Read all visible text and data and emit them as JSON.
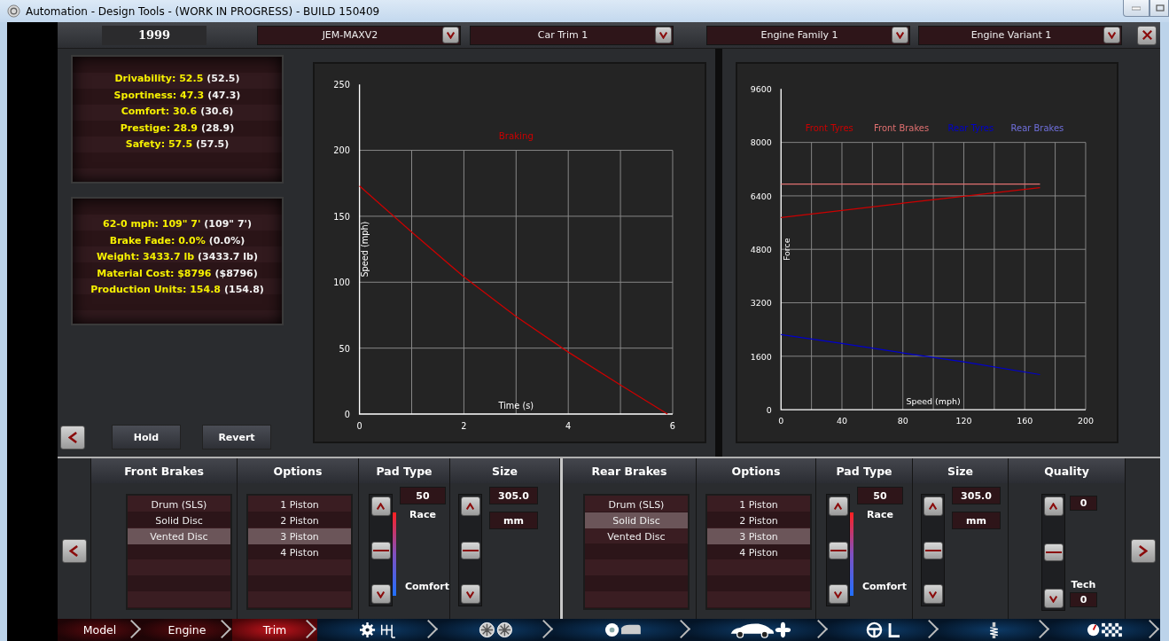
{
  "window": {
    "title": "Automation - Design Tools - (WORK IN PROGRESS) - BUILD 150409"
  },
  "top_bar": {
    "year": "1999",
    "dropdowns": [
      {
        "value": "JEM-MAXV2"
      },
      {
        "value": "Car Trim 1"
      },
      {
        "value": "Engine Family 1"
      },
      {
        "value": "Engine Variant 1"
      }
    ]
  },
  "rating_stats": [
    {
      "text": "Drivability: 52.5",
      "baseline": "(52.5)"
    },
    {
      "text": "Sportiness: 47.3",
      "baseline": "(47.3)"
    },
    {
      "text": "Comfort: 30.6",
      "baseline": "(30.6)"
    },
    {
      "text": "Prestige: 28.9",
      "baseline": "(28.9)"
    },
    {
      "text": "Safety: 57.5",
      "baseline": "(57.5)"
    }
  ],
  "performance_stats": [
    {
      "text": "62-0 mph: 109\" 7'",
      "baseline": "(109\" 7')"
    },
    {
      "text": "Brake Fade: 0.0%",
      "baseline": "(0.0%)"
    },
    {
      "text": "Weight: 3433.7 lb",
      "baseline": "(3433.7 lb)"
    },
    {
      "text": "Material Cost: $8796",
      "baseline": "($8796)"
    },
    {
      "text": "Production Units: 154.8",
      "baseline": "(154.8)"
    }
  ],
  "buttons": [
    "Hold",
    "Revert"
  ],
  "charts": [
    {
      "chart_data": {
        "type": "line",
        "grid": true,
        "xlabel": "Time (s)",
        "ylabel": "Speed (mph)",
        "x": [
          0,
          1,
          2,
          3,
          4,
          5,
          5.9
        ],
        "xlim": [
          0,
          6
        ],
        "ylim": [
          0,
          250
        ],
        "xticks": [
          0,
          2,
          4,
          6
        ],
        "yticks": [
          0,
          50,
          100,
          150,
          200,
          250
        ],
        "series": [
          {
            "name": "Braking",
            "color": "#cc0000",
            "values": [
              173,
              138,
              104,
              74,
              47,
              22,
              0
            ]
          }
        ]
      }
    },
    {
      "chart_data": {
        "type": "line",
        "grid": true,
        "xlabel": "Speed (mph)",
        "ylabel": "Force",
        "x": [
          0,
          40,
          80,
          120,
          170
        ],
        "xlim": [
          0,
          200
        ],
        "ylim": [
          0,
          9600
        ],
        "xticks": [
          0,
          40,
          80,
          120,
          160,
          200
        ],
        "yticks": [
          0,
          1600,
          3200,
          4800,
          6400,
          8000,
          9600
        ],
        "series": [
          {
            "name": "Front Tyres",
            "color": "#cc0000",
            "values": [
              5750,
              5960,
              6180,
              6390,
              6650
            ]
          },
          {
            "name": "Front Brakes",
            "color": "#e07070",
            "values": [
              6750,
              6750,
              6750,
              6750,
              6750
            ]
          },
          {
            "name": "Rear Tyres",
            "color": "#0000cc",
            "values": [
              2250,
              1980,
              1700,
              1430,
              1050
            ]
          },
          {
            "name": "Rear Brakes",
            "color": "#7070dd",
            "values": [
              null,
              null,
              null,
              null,
              null
            ]
          }
        ]
      }
    }
  ],
  "brake_panels": [
    {
      "kind": "front",
      "columns": [
        "Front Brakes",
        "Options",
        "Pad Type",
        "Size"
      ],
      "types": [
        {
          "label": "Drum (SLS)",
          "selected": false
        },
        {
          "label": "Solid Disc",
          "selected": false
        },
        {
          "label": "Vented Disc",
          "selected": true
        }
      ],
      "options": [
        {
          "label": "1 Piston",
          "selected": false
        },
        {
          "label": "2 Piston",
          "selected": false
        },
        {
          "label": "3 Piston",
          "selected": true
        },
        {
          "label": "4 Piston",
          "selected": false
        }
      ],
      "pad_type": {
        "value": "50",
        "high_label": "Race",
        "low_label": "Comfort",
        "level": 0.5
      },
      "size": {
        "value": "305.0",
        "unit": "mm",
        "level": 0.5
      }
    },
    {
      "kind": "rear",
      "columns": [
        "Rear Brakes",
        "Options",
        "Pad Type",
        "Size",
        "Quality"
      ],
      "types": [
        {
          "label": "Drum (SLS)",
          "selected": false
        },
        {
          "label": "Solid Disc",
          "selected": true
        },
        {
          "label": "Vented Disc",
          "selected": false
        }
      ],
      "options": [
        {
          "label": "1 Piston",
          "selected": false
        },
        {
          "label": "2 Piston",
          "selected": false
        },
        {
          "label": "3 Piston",
          "selected": true
        },
        {
          "label": "4 Piston",
          "selected": false
        }
      ],
      "pad_type": {
        "value": "50",
        "high_label": "Race",
        "low_label": "Comfort",
        "level": 0.5
      },
      "size": {
        "value": "305.0",
        "unit": "mm",
        "level": 0.5
      },
      "quality": {
        "value": "0",
        "tech_label": "Tech",
        "tech_value": "0",
        "level": 0.5
      }
    }
  ],
  "nav_tabs": [
    {
      "kind": "text",
      "label": "Model",
      "selected": false
    },
    {
      "kind": "text",
      "label": "Engine",
      "selected": false
    },
    {
      "kind": "text",
      "label": "Trim",
      "selected": true
    },
    {
      "kind": "icon",
      "selected": false
    },
    {
      "kind": "icon",
      "selected": false
    },
    {
      "kind": "icon",
      "selected": false
    },
    {
      "kind": "icon",
      "selected": false
    },
    {
      "kind": "icon",
      "selected": false
    },
    {
      "kind": "icon",
      "selected": false
    },
    {
      "kind": "icon",
      "selected": false
    }
  ]
}
